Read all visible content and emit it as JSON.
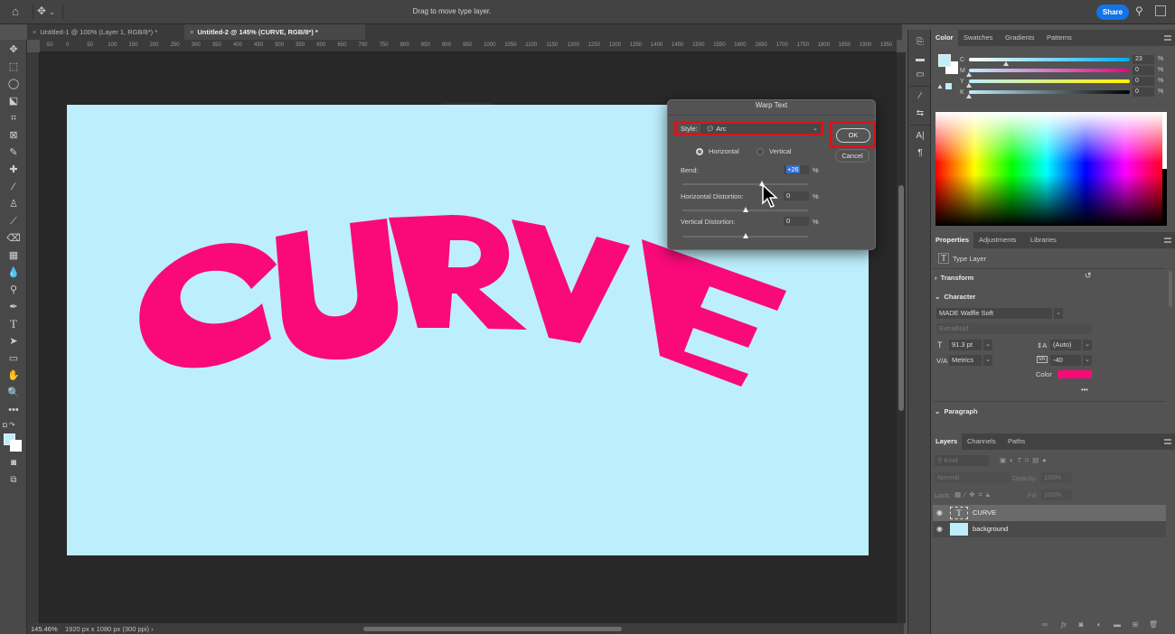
{
  "topbar": {
    "home_icon": "home-icon",
    "move_tool_icon": "move-icon",
    "hint": "Drag to move type layer.",
    "share_label": "Share",
    "search_icon": "search-icon",
    "panel_toggle_icon": "panel-layout-icon"
  },
  "tabs": [
    {
      "label": "Untitled-1 @ 100% (Layer 1, RGB/8*) *",
      "active": false
    },
    {
      "label": "Untitled-2 @ 145% (CURVE, RGB/8*) *",
      "active": true
    }
  ],
  "ruler_ticks": [
    "-50",
    "0",
    "50",
    "100",
    "150",
    "200",
    "250",
    "300",
    "350",
    "400",
    "450",
    "500",
    "550",
    "600",
    "650",
    "700",
    "750",
    "800",
    "850",
    "900",
    "950",
    "1000",
    "1050",
    "1100",
    "1150",
    "1200",
    "1250",
    "1300",
    "1350",
    "1400",
    "1450",
    "1500",
    "1550",
    "1600",
    "1650",
    "1700",
    "1750",
    "1800",
    "1850",
    "1900",
    "1950"
  ],
  "tools": [
    "move",
    "marquee",
    "lasso",
    "object-select",
    "crop",
    "frame",
    "eyedropper",
    "healing-brush",
    "brush",
    "clone-stamp",
    "history-brush",
    "eraser",
    "gradient",
    "blur",
    "dodge",
    "pen",
    "type",
    "path-select",
    "rectangle",
    "hand",
    "zoom",
    "more",
    "default-colors",
    "swap-colors",
    "quick-mask",
    "screen-mode"
  ],
  "canvas": {
    "text": "CURVE",
    "background_color": "#bdeefc",
    "text_color": "#f90a78"
  },
  "status": {
    "zoom": "145.46%",
    "doc_info": "1920 px x 1080 px (300 ppi)",
    "arrow": "›"
  },
  "warp_dialog": {
    "title": "Warp Text",
    "style_label": "Style:",
    "style_value": "Arc",
    "style_icon": "arc-warp-icon",
    "ok_label": "OK",
    "cancel_label": "Cancel",
    "orientation": {
      "horizontal_label": "Horizontal",
      "vertical_label": "Vertical",
      "selected": "Horizontal"
    },
    "bend": {
      "label": "Bend:",
      "value": "+26",
      "unit": "%",
      "percent": 26
    },
    "horizontal_distortion": {
      "label": "Horizontal Distortion:",
      "value": "0",
      "unit": "%",
      "percent": 0
    },
    "vertical_distortion": {
      "label": "Vertical Distortion:",
      "value": "0",
      "unit": "%",
      "percent": 0
    },
    "highlight_color": "#d9141b"
  },
  "color_panel": {
    "tabs": [
      "Color",
      "Swatches",
      "Gradients",
      "Patterns"
    ],
    "active_tab": "Color",
    "channels": [
      {
        "label": "C",
        "value": "23",
        "unit": "%",
        "percent": 23
      },
      {
        "label": "M",
        "value": "0",
        "unit": "%",
        "percent": 0
      },
      {
        "label": "Y",
        "value": "0",
        "unit": "%",
        "percent": 0
      },
      {
        "label": "K",
        "value": "0",
        "unit": "%",
        "percent": 0
      }
    ],
    "foreground": "#bdeefc",
    "background": "#ffffff"
  },
  "properties_panel": {
    "tabs": [
      "Properties",
      "Adjustments",
      "Libraries"
    ],
    "active_tab": "Properties",
    "layer_type": "Type Layer",
    "transform_label": "Transform",
    "character_label": "Character",
    "font_family": "MADE Waffle Soft",
    "font_style": "ExtraBold",
    "font_size": "91.3 pt",
    "leading": "(Auto)",
    "kerning": "Metrics",
    "tracking": "-40",
    "color_label": "Color",
    "color_value": "#f90a78",
    "more": "•••",
    "paragraph_label": "Paragraph"
  },
  "layers_panel": {
    "tabs": [
      "Layers",
      "Channels",
      "Paths"
    ],
    "active_tab": "Layers",
    "filter_placeholder": "Kind",
    "blend_mode": "Normal",
    "opacity_label": "Opacity:",
    "opacity_value": "100%",
    "lock_label": "Lock:",
    "fill_label": "Fill:",
    "fill_value": "100%",
    "layers": [
      {
        "name": "CURVE",
        "type": "text",
        "selected": true,
        "visible": true
      },
      {
        "name": "background",
        "type": "fill",
        "selected": false,
        "visible": true,
        "swatch": "#bdeefc"
      }
    ],
    "footer_icons": [
      "link-icon",
      "fx-icon",
      "mask-icon",
      "adjustment-icon",
      "group-icon",
      "new-layer-icon",
      "delete-icon"
    ]
  }
}
